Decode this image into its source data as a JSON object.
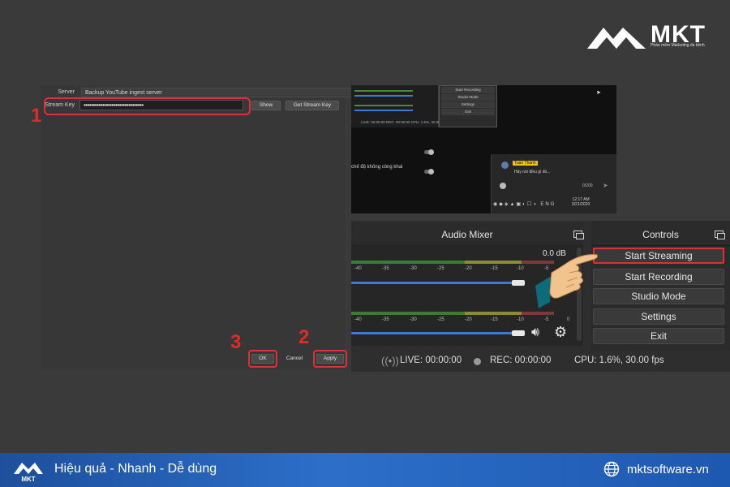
{
  "brand": {
    "name": "MKT",
    "tagline": "Phần mềm Marketing đa kênh"
  },
  "settings": {
    "server_label": "Server",
    "server_value": "Backup YouTube ingest server",
    "stream_key_label": "Stream Key",
    "stream_key_value": "••••••••••••••••••••••••••••••••",
    "show_button": "Show",
    "get_key_button": "Get Stream Key",
    "ok_button": "OK",
    "cancel_button": "Cancel",
    "apply_button": "Apply"
  },
  "callouts": [
    "1",
    "2",
    "3"
  ],
  "screenshot": {
    "popup_items": [
      "Start Recording",
      "Studio Mode",
      "Settings",
      "Exit"
    ],
    "mini_status": "LIVE: 00:00:00   REC: 00:00:00   CPU: 1.6%, 30.00 fps",
    "mode_text": "chế độ không công khai",
    "chat_name": "Tuan Thanh",
    "chat_message": "Hãy nói điều gì đó...",
    "chat_counter": "0/200",
    "taskbar_time": "12:17 AM",
    "taskbar_date": "9/21/2020"
  },
  "mixer": {
    "title": "Audio Mixer",
    "db_value": "0.0 dB",
    "scale_ticks": [
      "-40",
      "-35",
      "-30",
      "-25",
      "-20",
      "-15",
      "-10",
      "-5",
      "0"
    ]
  },
  "controls": {
    "title": "Controls",
    "start_streaming": "Start Streaming",
    "start_recording": "Start Recording",
    "studio_mode": "Studio Mode",
    "settings": "Settings",
    "exit": "Exit"
  },
  "status": {
    "live": "LIVE: 00:00:00",
    "rec": "REC: 00:00:00",
    "cpu": "CPU: 1.6%, 30.00 fps"
  },
  "footer": {
    "slogan": "Hiệu quả - Nhanh - Dễ dùng",
    "website": "mktsoftware.vn",
    "logo_text": "MKT"
  },
  "colors": {
    "accent_red": "#d9323a",
    "footer_blue": "#2c6fc9",
    "chat_name_bg": "#f1c40f"
  }
}
